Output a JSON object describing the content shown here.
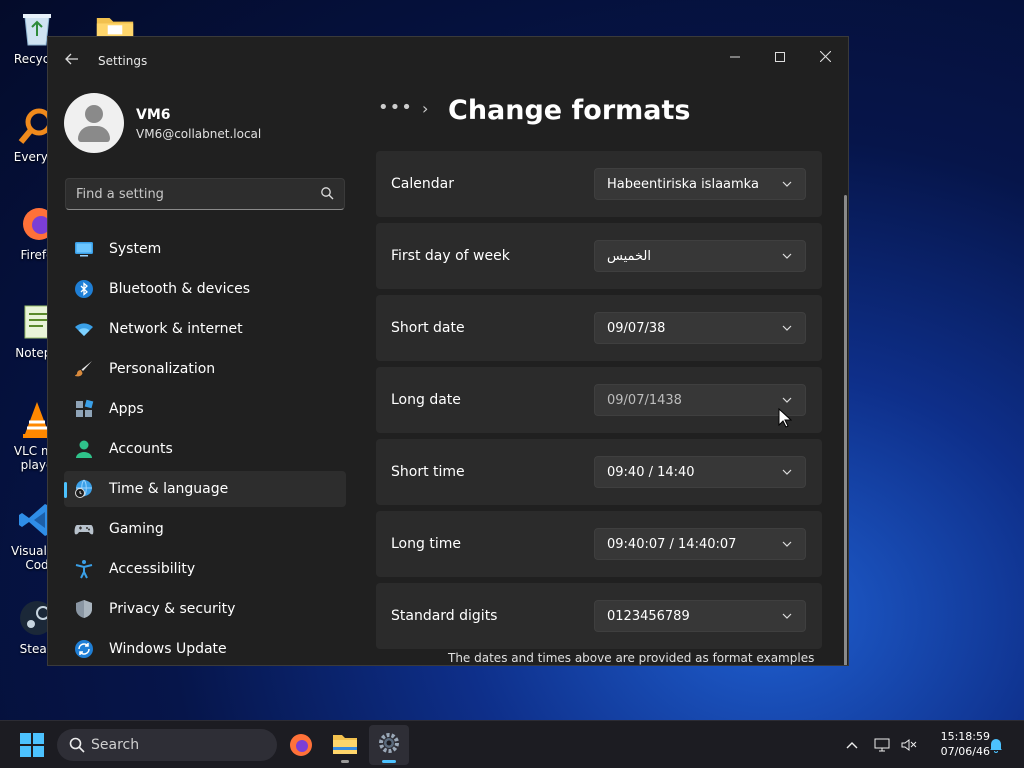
{
  "desktop": {
    "icons": [
      {
        "label": "Recycle",
        "icon": "recycle-bin-icon"
      },
      {
        "label": "Everyth",
        "icon": "everything-search-icon"
      },
      {
        "label": "Firefo",
        "icon": "firefox-icon"
      },
      {
        "label": "Notepa",
        "icon": "notepad-icon"
      },
      {
        "label_line1": "VLC me",
        "label_line2": "playe",
        "icon": "vlc-icon"
      },
      {
        "label_line1": "Visual St",
        "label_line2": "Cod",
        "icon": "vscode-icon"
      },
      {
        "label": "Stean",
        "icon": "steam-icon"
      }
    ]
  },
  "window": {
    "title": "Settings",
    "controls": {
      "minimize": "—",
      "maximize": "☐",
      "close": "✕"
    }
  },
  "profile": {
    "name": "VM6",
    "email": "VM6@collabnet.local"
  },
  "search": {
    "placeholder": "Find a setting"
  },
  "nav": {
    "items": [
      {
        "label": "System",
        "icon": "system-icon"
      },
      {
        "label": "Bluetooth & devices",
        "icon": "bluetooth-icon"
      },
      {
        "label": "Network & internet",
        "icon": "wifi-icon"
      },
      {
        "label": "Personalization",
        "icon": "brush-icon"
      },
      {
        "label": "Apps",
        "icon": "apps-icon"
      },
      {
        "label": "Accounts",
        "icon": "accounts-icon"
      },
      {
        "label": "Time & language",
        "icon": "time-language-icon",
        "active": true
      },
      {
        "label": "Gaming",
        "icon": "gamepad-icon"
      },
      {
        "label": "Accessibility",
        "icon": "accessibility-icon"
      },
      {
        "label": "Privacy & security",
        "icon": "shield-icon"
      },
      {
        "label": "Windows Update",
        "icon": "update-icon"
      }
    ]
  },
  "content": {
    "breadcrumb_dots": "•••",
    "breadcrumb_sep": "›",
    "title": "Change formats",
    "rows": [
      {
        "label": "Calendar",
        "value": "Habeentiriska islaamka"
      },
      {
        "label": "First day of week",
        "value": "الخميس"
      },
      {
        "label": "Short date",
        "value": "09/07/38"
      },
      {
        "label": "Long date",
        "value": "09/07/1438",
        "dimmed": true
      },
      {
        "label": "Short time",
        "value": "09:40 / 14:40"
      },
      {
        "label": "Long time",
        "value": "09:40:07 / 14:40:07"
      },
      {
        "label": "Standard digits",
        "value": "0123456789"
      }
    ],
    "footnote": "The dates and times above are provided as format examples"
  },
  "taskbar": {
    "search_placeholder": "Search",
    "clock_time": "15:18:59",
    "clock_date": "07/06/46"
  },
  "colors": {
    "accent": "#4cc2ff",
    "window_bg": "#202020",
    "card_bg": "#2b2b2b"
  }
}
